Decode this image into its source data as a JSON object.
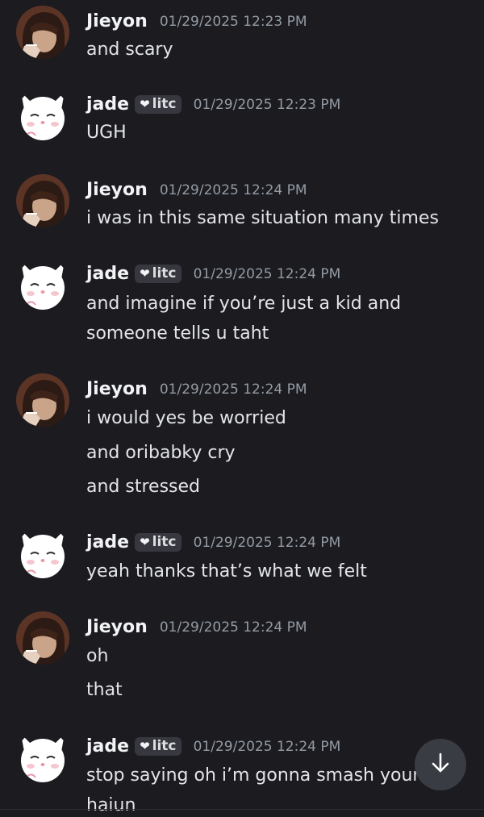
{
  "colors": {
    "background": "#1b1b20",
    "username": "#f2f3f5",
    "timestamp": "#949ba4",
    "message_text": "#e3e5e8",
    "badge_bg": "#37373f"
  },
  "users": {
    "jieyon": {
      "name": "Jieyon",
      "avatar": "dark-haired-character-avatar"
    },
    "jade": {
      "name": "jade",
      "badge": "litc",
      "badge_icon": "heart-icon",
      "avatar": "white-cat-avatar"
    }
  },
  "messages": [
    {
      "author": "Jieyon",
      "timestamp": "01/29/2025 12:23 PM",
      "lines": [
        "and scary"
      ]
    },
    {
      "author": "jade",
      "badge": "litc",
      "timestamp": "01/29/2025 12:23 PM",
      "lines": [
        "UGH"
      ]
    },
    {
      "author": "Jieyon",
      "timestamp": "01/29/2025 12:24 PM",
      "lines": [
        "i was in this same situation many times"
      ]
    },
    {
      "author": "jade",
      "badge": "litc",
      "timestamp": "01/29/2025 12:24 PM",
      "lines": [
        "and imagine if you’re just a kid and",
        "someone tells u taht"
      ]
    },
    {
      "author": "Jieyon",
      "timestamp": "01/29/2025 12:24 PM",
      "lines": [
        "i would yes be worried",
        "and oribabky cry",
        "and stressed"
      ]
    },
    {
      "author": "jade",
      "badge": "litc",
      "timestamp": "01/29/2025 12:24 PM",
      "lines": [
        "yeah thanks that’s what we felt"
      ]
    },
    {
      "author": "Jieyon",
      "timestamp": "01/29/2025 12:24 PM",
      "lines": [
        "oh",
        "that"
      ]
    },
    {
      "author": "jade",
      "badge": "litc",
      "timestamp": "01/29/2025 12:24 PM",
      "lines": [
        "stop saying oh i’m gonna smash your",
        "haiun"
      ]
    }
  ],
  "jump_button": {
    "icon": "arrow-down-icon"
  }
}
